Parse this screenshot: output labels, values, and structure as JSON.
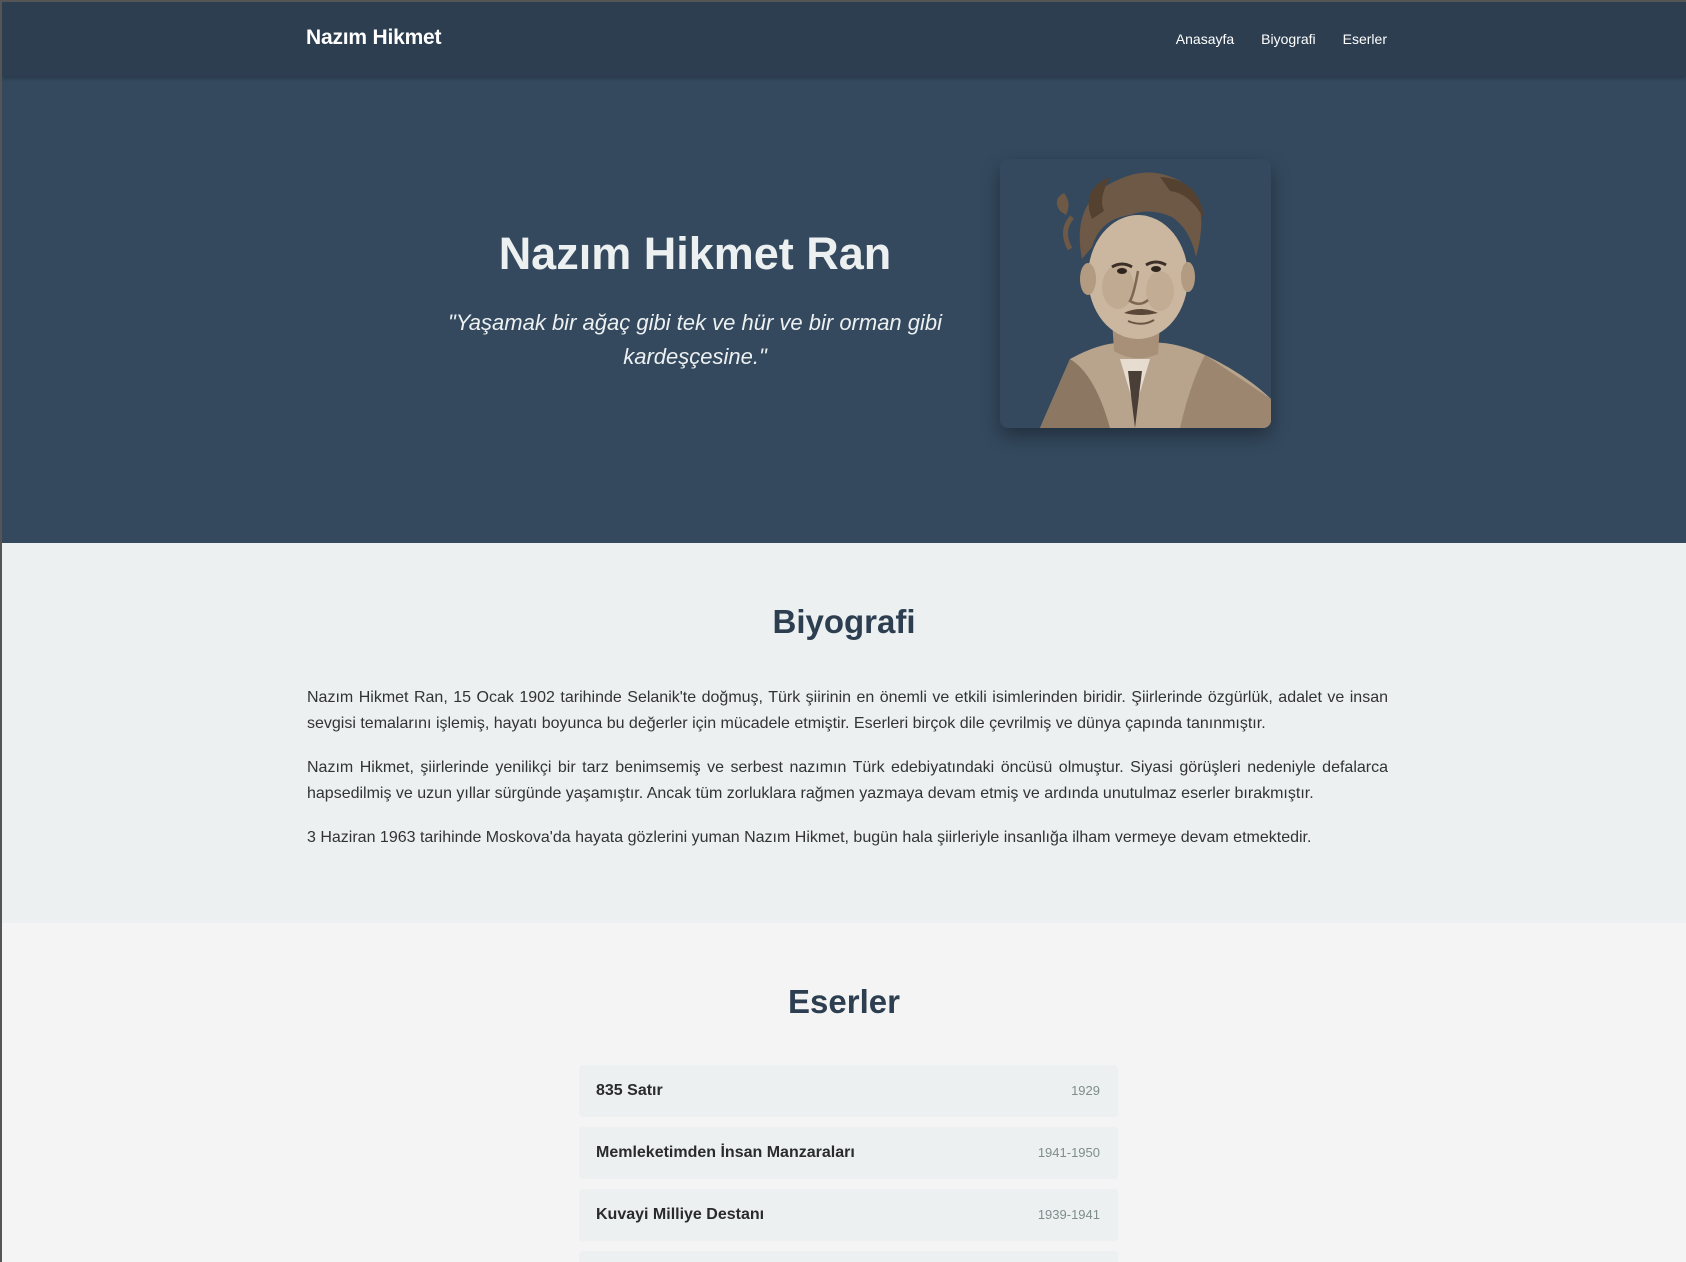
{
  "nav": {
    "brand": "Nazım Hikmet",
    "links": [
      "Anasayfa",
      "Biyografi",
      "Eserler"
    ]
  },
  "hero": {
    "title": "Nazım Hikmet Ran",
    "quote": "\"Yaşamak bir ağaç gibi tek ve hür ve bir orman gibi kardeşçesine.\""
  },
  "biography": {
    "title": "Biyografi",
    "paragraphs": [
      "Nazım Hikmet Ran, 15 Ocak 1902 tarihinde Selanik'te doğmuş, Türk şiirinin en önemli ve etkili isimlerinden biridir. Şiirlerinde özgürlük, adalet ve insan sevgisi temalarını işlemiş, hayatı boyunca bu değerler için mücadele etmiştir. Eserleri birçok dile çevrilmiş ve dünya çapında tanınmıştır.",
      "Nazım Hikmet, şiirlerinde yenilikçi bir tarz benimsemiş ve serbest nazımın Türk edebiyatındaki öncüsü olmuştur. Siyasi görüşleri nedeniyle defalarca hapsedilmiş ve uzun yıllar sürgünde yaşamıştır. Ancak tüm zorluklara rağmen yazmaya devam etmiş ve ardında unutulmaz eserler bırakmıştır.",
      "3 Haziran 1963 tarihinde Moskova'da hayata gözlerini yuman Nazım Hikmet, bugün hala şiirleriyle insanlığa ilham vermeye devam etmektedir."
    ]
  },
  "works": {
    "title": "Eserler",
    "items": [
      {
        "name": "835 Satır",
        "year": "1929"
      },
      {
        "name": "Memleketimden İnsan Manzaraları",
        "year": "1941-1950"
      },
      {
        "name": "Kuvayi Milliye Destanı",
        "year": "1939-1941"
      },
      {
        "name": "",
        "year": ""
      }
    ]
  },
  "colors": {
    "navbar": "#2c3e50",
    "hero": "#34495e",
    "bio_bg": "#ecf0f1",
    "works_bg": "#f4f4f4"
  }
}
